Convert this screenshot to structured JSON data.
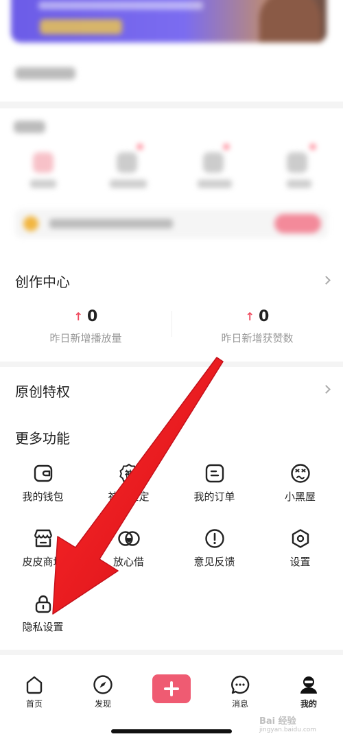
{
  "creation_center": {
    "title": "创作中心",
    "stats": [
      {
        "value": "0",
        "label": "昨日新增播放量"
      },
      {
        "value": "0",
        "label": "昨日新增获赞数"
      }
    ]
  },
  "original_privilege": {
    "title": "原创特权"
  },
  "more_functions": {
    "title": "更多功能",
    "items": [
      {
        "label": "我的钱包",
        "icon": "wallet-icon"
      },
      {
        "label": "神评鉴定",
        "icon": "shen-badge-icon",
        "badge_char": "神"
      },
      {
        "label": "我的订单",
        "icon": "order-icon"
      },
      {
        "label": "小黑屋",
        "icon": "dizzy-face-icon"
      },
      {
        "label": "皮皮商城",
        "icon": "shop-icon"
      },
      {
        "label": "放心借",
        "icon": "heart-loan-icon"
      },
      {
        "label": "意见反馈",
        "icon": "feedback-icon"
      },
      {
        "label": "设置",
        "icon": "settings-icon"
      },
      {
        "label": "隐私设置",
        "icon": "lock-icon"
      }
    ]
  },
  "bottom_nav": {
    "items": [
      {
        "label": "首页",
        "icon": "home-icon"
      },
      {
        "label": "发现",
        "icon": "compass-icon"
      },
      {
        "label": "",
        "icon": "plus-icon"
      },
      {
        "label": "消息",
        "icon": "message-icon"
      },
      {
        "label": "我的",
        "icon": "profile-icon",
        "active": true
      }
    ]
  },
  "watermark": {
    "text": "Bai 经验",
    "sub": "jingyan.baidu.com"
  },
  "colors": {
    "accent": "#ef5b72",
    "arrow": "#e8121e",
    "up_arrow": "#ef4a5e",
    "label_gray": "#999999"
  }
}
